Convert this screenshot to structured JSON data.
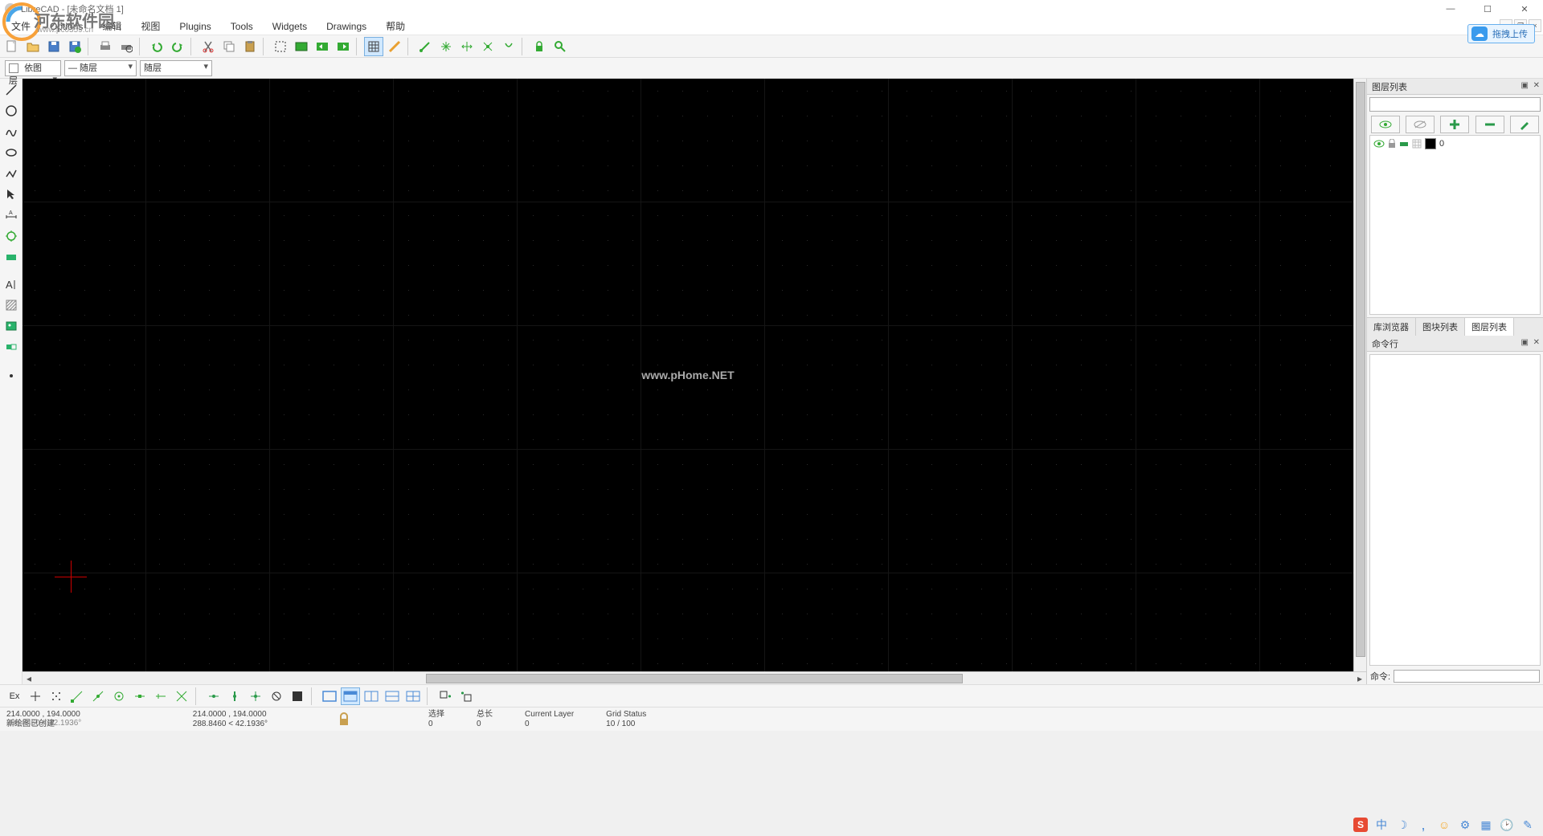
{
  "window": {
    "title": "LibreCAD - [未命名文档 1]",
    "win_min": "—",
    "win_max": "☐",
    "win_close": "✕"
  },
  "watermark": {
    "site_text": "河东软件园",
    "site_url": "www.pc0359.cn",
    "canvas_mark": "www.pHome.NET"
  },
  "drag_upload": {
    "label": "拖拽上传"
  },
  "menu": {
    "items": [
      "文件",
      "Options",
      "编辑",
      "视图",
      "Plugins",
      "Tools",
      "Widgets",
      "Drawings",
      "帮助"
    ]
  },
  "doc_controls": {
    "min": "–",
    "max": "❐",
    "close": "×"
  },
  "pen_row": {
    "color_label": "依图层",
    "width_label": "— 随层",
    "type_label": "随层"
  },
  "layer_panel": {
    "title": "图层列表",
    "filter_placeholder": "",
    "layer0": {
      "name": "0"
    },
    "tabs": [
      "库浏览器",
      "图块列表",
      "图层列表"
    ]
  },
  "cmd_panel": {
    "title": "命令行",
    "prompt": "命令:"
  },
  "bottom_toolbar": {
    "ex_label": "Ex"
  },
  "status": {
    "abs_coords": "214.0000 , 194.0000",
    "rel_coords": "288.8460 < 42.1936°",
    "abs_coords2": "214.0000 , 194.0000",
    "rel_coords2": "288.8460 < 42.1936°",
    "msg": "新绘图已创建",
    "sel_label": "选择",
    "sel_value": "0",
    "len_label": "总长",
    "len_value": "0",
    "layer_label": "Current Layer",
    "layer_value": "0",
    "grid_label": "Grid Status",
    "grid_value": "10 / 100"
  },
  "tray": {
    "items": [
      "S",
      "中",
      "☽",
      ",",
      "☺",
      "⚙",
      "▦",
      "🕑",
      "✎"
    ]
  }
}
